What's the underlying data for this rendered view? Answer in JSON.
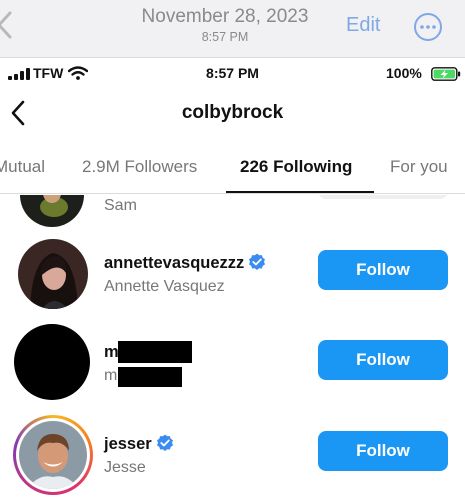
{
  "viewer": {
    "date": "November 28, 2023",
    "time": "8:57 PM",
    "edit_label": "Edit",
    "icons": {
      "back": "chevron-left-icon",
      "more": "ellipsis-circle-icon"
    }
  },
  "status_bar": {
    "carrier": "TFW",
    "time": "8:57 PM",
    "battery": "100%",
    "battery_level": 1.0,
    "icons": {
      "signal": "signal-bars-icon",
      "wifi": "wifi-icon",
      "battery": "battery-charging-icon"
    }
  },
  "profile": {
    "username": "colbybrock",
    "icons": {
      "back": "chevron-left-icon"
    }
  },
  "tabs": [
    {
      "label": "Mutual"
    },
    {
      "label": "2.9M Followers"
    },
    {
      "label": "226 Following",
      "active": true
    },
    {
      "label": "For you"
    }
  ],
  "list": [
    {
      "handle": "",
      "name": "Sam",
      "verified": false,
      "button": ""
    },
    {
      "handle": "annettevasquezzz",
      "name": "Annette Vasquez",
      "verified": true,
      "button": "Follow"
    },
    {
      "handle": "m",
      "name": "m",
      "verified": false,
      "redacted": true,
      "button": "Follow"
    },
    {
      "handle": "jesser",
      "name": "Jesse",
      "verified": true,
      "button": "Follow",
      "story_ring": true
    }
  ],
  "colors": {
    "accent": "#1a97f5",
    "verified": "#3b8cf0",
    "muted_text": "#777777",
    "viewer_link": "#7fa8e6",
    "battery": "#4cd964"
  }
}
